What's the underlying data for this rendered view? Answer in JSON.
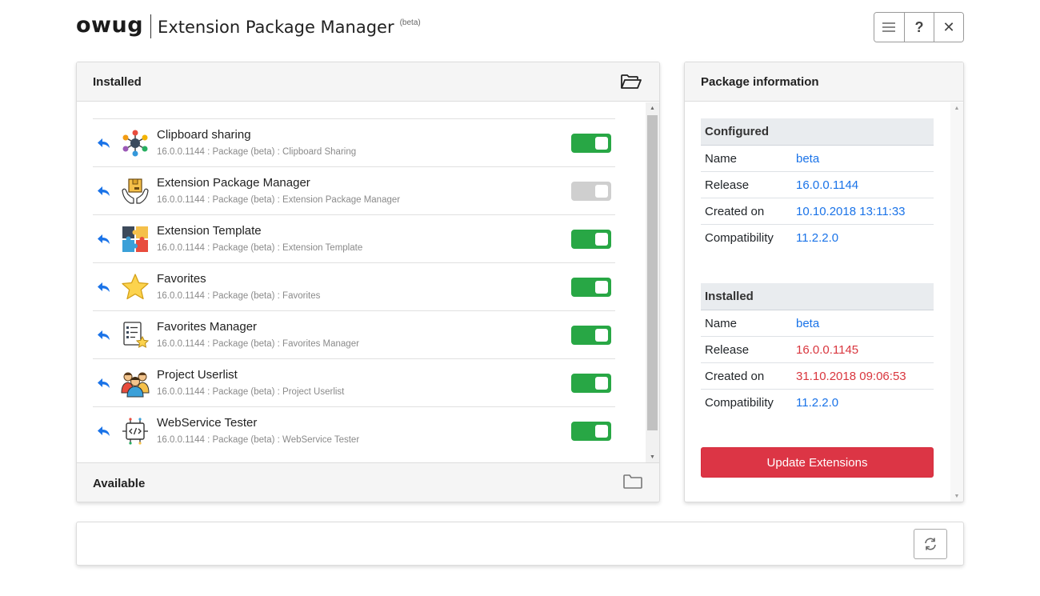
{
  "header": {
    "brand": "owug",
    "title": "Extension Package Manager",
    "beta": "(beta)"
  },
  "toolbar": {
    "menu_icon": "hamburger-menu-icon",
    "help_label": "?",
    "close_label": "✕"
  },
  "installed": {
    "title": "Installed",
    "packages": [
      {
        "name": "Clipboard sharing",
        "subtitle": "16.0.0.1144 : Package (beta) : Clipboard Sharing",
        "enabled": true,
        "icon": "network-nodes-icon"
      },
      {
        "name": "Extension Package Manager",
        "subtitle": "16.0.0.1144 : Package (beta) : Extension Package Manager",
        "enabled": false,
        "icon": "hands-box-icon"
      },
      {
        "name": "Extension Template",
        "subtitle": "16.0.0.1144 : Package (beta) : Extension Template",
        "enabled": true,
        "icon": "puzzle-icon"
      },
      {
        "name": "Favorites",
        "subtitle": "16.0.0.1144 : Package (beta) : Favorites",
        "enabled": true,
        "icon": "star-icon"
      },
      {
        "name": "Favorites Manager",
        "subtitle": "16.0.0.1144 : Package (beta) : Favorites Manager",
        "enabled": true,
        "icon": "checklist-star-icon"
      },
      {
        "name": "Project Userlist",
        "subtitle": "16.0.0.1144 : Package (beta) : Project Userlist",
        "enabled": true,
        "icon": "user-group-icon"
      },
      {
        "name": "WebService Tester",
        "subtitle": "16.0.0.1144 : Package (beta) : WebService Tester",
        "enabled": true,
        "icon": "code-chip-icon"
      }
    ]
  },
  "available": {
    "title": "Available"
  },
  "package_info": {
    "title": "Package information",
    "configured": {
      "title": "Configured",
      "rows": [
        {
          "key": "Name",
          "value": "beta"
        },
        {
          "key": "Release",
          "value": "16.0.0.1144"
        },
        {
          "key": "Created on",
          "value": "10.10.2018 13:11:33"
        },
        {
          "key": "Compatibility",
          "value": "11.2.2.0"
        }
      ]
    },
    "installed": {
      "title": "Installed",
      "rows": [
        {
          "key": "Name",
          "value": "beta",
          "highlight": false
        },
        {
          "key": "Release",
          "value": "16.0.0.1145",
          "highlight": true
        },
        {
          "key": "Created on",
          "value": "31.10.2018 09:06:53",
          "highlight": true
        },
        {
          "key": "Compatibility",
          "value": "11.2.2.0",
          "highlight": false
        }
      ]
    },
    "update_button": "Update Extensions"
  },
  "colors": {
    "toggle_on": "#28a745",
    "toggle_off": "#cfcfcf",
    "link_blue": "#1a73e8",
    "changed_red": "#d9363e",
    "danger": "#dc3545"
  }
}
